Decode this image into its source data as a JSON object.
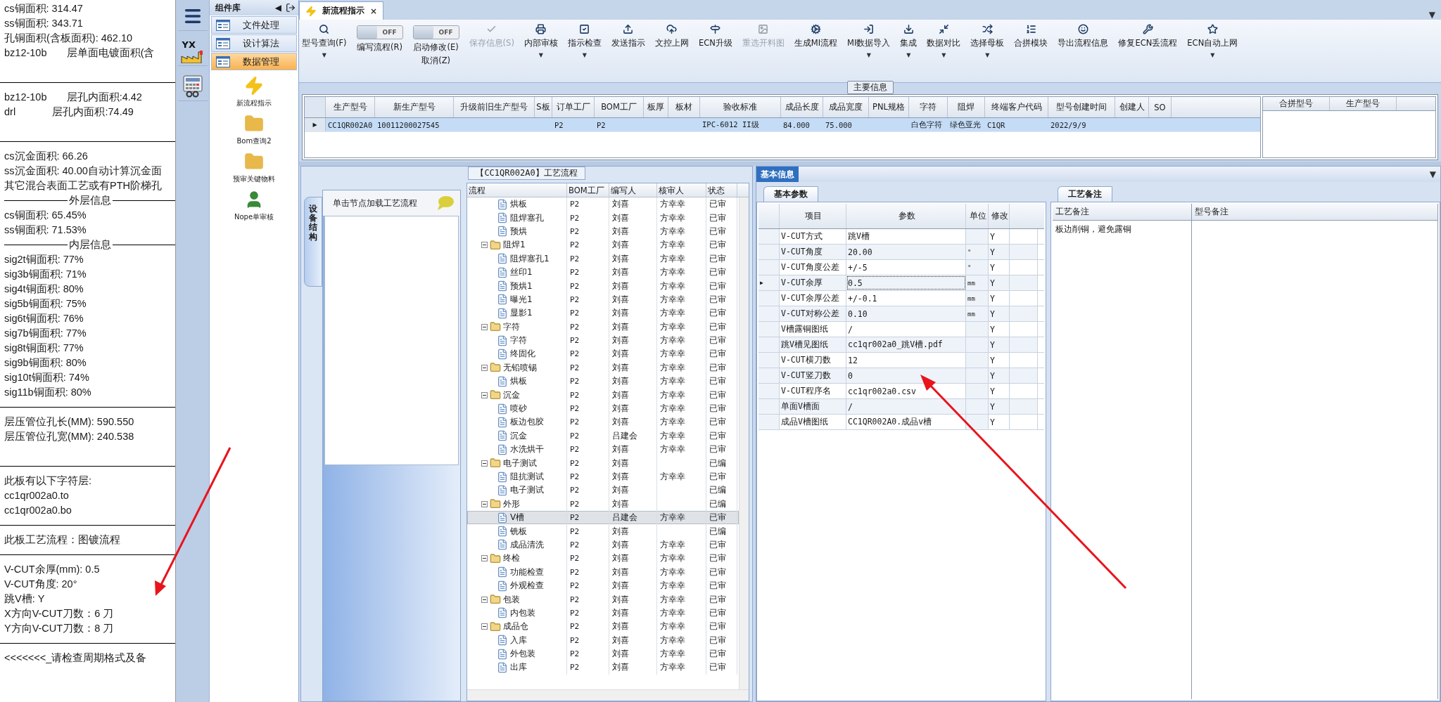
{
  "notes": [
    {
      "kind": "text",
      "text": "cs铜面积: 314.47"
    },
    {
      "kind": "text",
      "text": "ss铜面积: 343.71"
    },
    {
      "kind": "text",
      "text": "孔铜面积(含板面积): 462.10"
    },
    {
      "kind": "text",
      "text": "bz12-10b       层单面电镀面积(含"
    },
    {
      "kind": "gap"
    },
    {
      "kind": "rule"
    },
    {
      "kind": "text",
      "text": "bz12-10b       层孔内面积:4.42"
    },
    {
      "kind": "text",
      "text": "drl             层孔内面积:74.49"
    },
    {
      "kind": "gap"
    },
    {
      "kind": "rule"
    },
    {
      "kind": "text",
      "text": "cs沉金面积: 66.26"
    },
    {
      "kind": "text",
      "text": "ss沉金面积: 40.00自动计算沉金面"
    },
    {
      "kind": "text",
      "text": "其它混合表面工艺或有PTH阶梯孔"
    },
    {
      "kind": "heading",
      "text": "外层信息"
    },
    {
      "kind": "text",
      "text": "cs铜面积: 65.45%"
    },
    {
      "kind": "text",
      "text": "ss铜面积: 71.53%"
    },
    {
      "kind": "heading",
      "text": "内层信息"
    },
    {
      "kind": "text",
      "text": "sig2t铜面积: 77%"
    },
    {
      "kind": "text",
      "text": "sig3b铜面积: 71%"
    },
    {
      "kind": "text",
      "text": "sig4t铜面积: 80%"
    },
    {
      "kind": "text",
      "text": "sig5b铜面积: 75%"
    },
    {
      "kind": "text",
      "text": "sig6t铜面积: 76%"
    },
    {
      "kind": "text",
      "text": "sig7b铜面积: 77%"
    },
    {
      "kind": "text",
      "text": "sig8t铜面积: 77%"
    },
    {
      "kind": "text",
      "text": "sig9b铜面积: 80%"
    },
    {
      "kind": "text",
      "text": "sig10t铜面积: 74%"
    },
    {
      "kind": "text",
      "text": "sig11b铜面积: 80%"
    },
    {
      "kind": "rule"
    },
    {
      "kind": "text",
      "text": "层压管位孔长(MM): 590.550"
    },
    {
      "kind": "text",
      "text": "层压管位孔宽(MM): 240.538"
    },
    {
      "kind": "gap"
    },
    {
      "kind": "rule"
    },
    {
      "kind": "text",
      "text": "此板有以下字符层:"
    },
    {
      "kind": "text",
      "text": "cc1qr002a0.to"
    },
    {
      "kind": "text",
      "text": "cc1qr002a0.bo"
    },
    {
      "kind": "rule"
    },
    {
      "kind": "text",
      "text": "此板工艺流程：图镀流程"
    },
    {
      "kind": "rule"
    },
    {
      "kind": "text",
      "text": "V-CUT余厚(mm): 0.5"
    },
    {
      "kind": "text",
      "text": "V-CUT角度: 20°"
    },
    {
      "kind": "text",
      "text": "跳V槽: Y"
    },
    {
      "kind": "text",
      "text": "X方向V-CUT刀数：6 刀"
    },
    {
      "kind": "text",
      "text": "Y方向V-CUT刀数：8 刀"
    },
    {
      "kind": "rule"
    },
    {
      "kind": "text",
      "text": "<<<<<<<_请检查周期格式及备"
    }
  ],
  "app_badge": "YX",
  "library": {
    "title": "组件库",
    "back": "◀",
    "items": [
      {
        "label": "文件处理",
        "selected": false
      },
      {
        "label": "设计算法",
        "selected": false
      },
      {
        "label": "数据管理",
        "selected": true
      }
    ],
    "tools": [
      "新流程指示",
      "Bom查询2",
      "预审关键物料",
      "Nope单审核"
    ]
  },
  "tab": {
    "label": "新流程指示",
    "close": "×",
    "menu": "▼"
  },
  "toolbar": [
    {
      "kind": "button",
      "label": "型号查询(F)",
      "caret": "▼",
      "disabled": false
    },
    {
      "kind": "toggle",
      "label": "编写流程(R)",
      "switch_text": "OFF",
      "on": false
    },
    {
      "kind": "toggle",
      "label": "启动修改(E)",
      "sub_label": "取消(Z)",
      "switch_text": "OFF",
      "on": false
    },
    {
      "kind": "button",
      "label": "保存信息(S)",
      "disabled": true
    },
    {
      "kind": "button",
      "label": "内部审核",
      "caret": "▼",
      "disabled": false
    },
    {
      "kind": "button",
      "label": "指示检查",
      "caret": "▼",
      "disabled": false
    },
    {
      "kind": "button",
      "label": "发送指示",
      "disabled": false
    },
    {
      "kind": "button",
      "label": "文控上网",
      "disabled": false
    },
    {
      "kind": "button",
      "label": "ECN升级",
      "disabled": false
    },
    {
      "kind": "button",
      "label": "重选开料图",
      "disabled": true
    },
    {
      "kind": "button",
      "label": "生成MI流程",
      "disabled": false
    },
    {
      "kind": "button",
      "label": "MI数据导入",
      "caret": "▼",
      "disabled": false
    },
    {
      "kind": "button",
      "label": "集成",
      "caret": "▼",
      "disabled": false
    },
    {
      "kind": "button",
      "label": "数据对比",
      "caret": "▼",
      "disabled": false
    },
    {
      "kind": "button",
      "label": "选择母板",
      "caret": "▼",
      "disabled": false
    },
    {
      "kind": "button",
      "label": "合拼模块",
      "disabled": false
    },
    {
      "kind": "button",
      "label": "导出流程信息",
      "disabled": false
    },
    {
      "kind": "button",
      "label": "修复ECN丢流程",
      "disabled": false
    },
    {
      "kind": "button",
      "label": "ECN自动上网",
      "caret": "▼",
      "disabled": false
    }
  ],
  "main_info": {
    "title": "主要信息",
    "columns": [
      "生产型号",
      "新生产型号",
      "升级前旧生产型号",
      "S板",
      "订单工厂",
      "BOM工厂",
      "板厚",
      "板材",
      "验收标准",
      "成品长度",
      "成品宽度",
      "PNL规格",
      "字符",
      "阻焊",
      "终端客户代码",
      "型号创建时间",
      "创建人",
      "SO"
    ],
    "rows": [
      {
        "selected": true,
        "indicator": "▶",
        "cells": [
          "CC1QR002A0",
          "10011200027545",
          null,
          null,
          "P2",
          "P2",
          null,
          null,
          "IPC-6012 II级",
          "84.000",
          "75.000",
          null,
          "白色字符",
          "绿色亚光",
          "C1QR",
          "2022/9/9",
          null,
          null
        ]
      }
    ],
    "side_columns": [
      "合拼型号",
      "生产型号"
    ]
  },
  "process": {
    "title": "【CC1QR002A0】工艺流程",
    "side_tab": "设备结构",
    "hint": "单击节点加载工艺流程",
    "columns": [
      "流程",
      "BOM工厂",
      "编写人",
      "核审人",
      "状态"
    ],
    "tree": [
      {
        "children": [
          {
            "name": "烘板",
            "factory": "P2",
            "writer": "刘喜",
            "reviewer": "方幸幸",
            "status": "已审",
            "selected": false
          },
          {
            "name": "阻焊塞孔",
            "factory": "P2",
            "writer": "刘喜",
            "reviewer": "方幸幸",
            "status": "已审",
            "selected": false
          },
          {
            "name": "预烘",
            "factory": "P2",
            "writer": "刘喜",
            "reviewer": "方幸幸",
            "status": "已审",
            "selected": false
          }
        ]
      },
      {
        "name": "阻焊1",
        "factory": "P2",
        "writer": "刘喜",
        "reviewer": "方幸幸",
        "status": "已审",
        "selected": false,
        "children": [
          {
            "name": "阻焊塞孔1",
            "factory": "P2",
            "writer": "刘喜",
            "reviewer": "方幸幸",
            "status": "已审",
            "selected": false
          },
          {
            "name": "丝印1",
            "factory": "P2",
            "writer": "刘喜",
            "reviewer": "方幸幸",
            "status": "已审",
            "selected": false
          },
          {
            "name": "预烘1",
            "factory": "P2",
            "writer": "刘喜",
            "reviewer": "方幸幸",
            "status": "已审",
            "selected": false
          },
          {
            "name": "曝光1",
            "factory": "P2",
            "writer": "刘喜",
            "reviewer": "方幸幸",
            "status": "已审",
            "selected": false
          },
          {
            "name": "显影1",
            "factory": "P2",
            "writer": "刘喜",
            "reviewer": "方幸幸",
            "status": "已审",
            "selected": false
          }
        ]
      },
      {
        "name": "字符",
        "factory": "P2",
        "writer": "刘喜",
        "reviewer": "方幸幸",
        "status": "已审",
        "selected": false,
        "children": [
          {
            "name": "字符",
            "factory": "P2",
            "writer": "刘喜",
            "reviewer": "方幸幸",
            "status": "已审",
            "selected": false
          },
          {
            "name": "终固化",
            "factory": "P2",
            "writer": "刘喜",
            "reviewer": "方幸幸",
            "status": "已审",
            "selected": false
          }
        ]
      },
      {
        "name": "无铅喷锡",
        "factory": "P2",
        "writer": "刘喜",
        "reviewer": "方幸幸",
        "status": "已审",
        "selected": false,
        "children": [
          {
            "name": "烘板",
            "factory": "P2",
            "writer": "刘喜",
            "reviewer": "方幸幸",
            "status": "已审",
            "selected": false
          }
        ]
      },
      {
        "name": "沉金",
        "factory": "P2",
        "writer": "刘喜",
        "reviewer": "方幸幸",
        "status": "已审",
        "selected": false,
        "children": [
          {
            "name": "喷砂",
            "factory": "P2",
            "writer": "刘喜",
            "reviewer": "方幸幸",
            "status": "已审",
            "selected": false
          },
          {
            "name": "板边包胶",
            "factory": "P2",
            "writer": "刘喜",
            "reviewer": "方幸幸",
            "status": "已审",
            "selected": false
          },
          {
            "name": "沉金",
            "factory": "P2",
            "writer": "吕建会",
            "reviewer": "方幸幸",
            "status": "已审",
            "selected": false
          },
          {
            "name": "水洗烘干",
            "factory": "P2",
            "writer": "刘喜",
            "reviewer": "方幸幸",
            "status": "已审",
            "selected": false
          }
        ]
      },
      {
        "name": "电子测试",
        "factory": "P2",
        "writer": "刘喜",
        "status": "已编",
        "selected": false,
        "children": [
          {
            "name": "阻抗测试",
            "factory": "P2",
            "writer": "刘喜",
            "reviewer": "方幸幸",
            "status": "已审",
            "selected": false
          },
          {
            "name": "电子测试",
            "factory": "P2",
            "writer": "刘喜",
            "status": "已编",
            "selected": false
          }
        ]
      },
      {
        "name": "外形",
        "factory": "P2",
        "writer": "刘喜",
        "status": "已编",
        "selected": false,
        "children": [
          {
            "name": "V槽",
            "factory": "P2",
            "writer": "吕建会",
            "reviewer": "方幸幸",
            "status": "已审",
            "selected": true
          },
          {
            "name": "铣板",
            "factory": "P2",
            "writer": "刘喜",
            "status": "已编",
            "selected": false
          },
          {
            "name": "成品清洗",
            "factory": "P2",
            "writer": "刘喜",
            "reviewer": "方幸幸",
            "status": "已审",
            "selected": false
          }
        ]
      },
      {
        "name": "终检",
        "factory": "P2",
        "writer": "刘喜",
        "reviewer": "方幸幸",
        "status": "已审",
        "selected": false,
        "children": [
          {
            "name": "功能检查",
            "factory": "P2",
            "writer": "刘喜",
            "reviewer": "方幸幸",
            "status": "已审",
            "selected": false
          },
          {
            "name": "外观检查",
            "factory": "P2",
            "writer": "刘喜",
            "reviewer": "方幸幸",
            "status": "已审",
            "selected": false
          }
        ]
      },
      {
        "name": "包装",
        "factory": "P2",
        "writer": "刘喜",
        "reviewer": "方幸幸",
        "status": "已审",
        "selected": false,
        "children": [
          {
            "name": "内包装",
            "factory": "P2",
            "writer": "刘喜",
            "reviewer": "方幸幸",
            "status": "已审",
            "selected": false
          }
        ]
      },
      {
        "name": "成品仓",
        "factory": "P2",
        "writer": "刘喜",
        "reviewer": "方幸幸",
        "status": "已审",
        "selected": false,
        "children": [
          {
            "name": "入库",
            "factory": "P2",
            "writer": "刘喜",
            "reviewer": "方幸幸",
            "status": "已审",
            "selected": false
          },
          {
            "name": "外包装",
            "factory": "P2",
            "writer": "刘喜",
            "reviewer": "方幸幸",
            "status": "已审",
            "selected": false
          },
          {
            "name": "出库",
            "factory": "P2",
            "writer": "刘喜",
            "reviewer": "方幸幸",
            "status": "已审",
            "selected": false
          }
        ]
      }
    ]
  },
  "basic": {
    "title": "基本信息",
    "params_tab": "基本参数",
    "columns": [
      "项目",
      "参数",
      "单位",
      "修改"
    ],
    "params": [
      {
        "item": "V-CUT方式",
        "value": "跳V槽",
        "modified": "Y",
        "selected": false
      },
      {
        "item": "V-CUT角度",
        "value": "20.00",
        "unit": "°",
        "modified": "Y",
        "selected": false
      },
      {
        "item": "V-CUT角度公差",
        "value": "+/-5",
        "unit": "°",
        "modified": "Y",
        "selected": false
      },
      {
        "item": "V-CUT余厚",
        "value": "0.5",
        "unit": "mm",
        "modified": "Y",
        "selected": true,
        "indicator": "▶"
      },
      {
        "item": "V-CUT余厚公差",
        "value": "+/-0.1",
        "unit": "mm",
        "modified": "Y",
        "selected": false
      },
      {
        "item": "V-CUT对称公差",
        "value": "0.10",
        "unit": "mm",
        "modified": "Y",
        "selected": false
      },
      {
        "item": "V槽露铜图纸",
        "value": "/",
        "modified": "Y",
        "selected": false
      },
      {
        "item": "跳V槽见图纸",
        "value": "cc1qr002a0_跳V槽.pdf",
        "modified": "Y",
        "selected": false
      },
      {
        "item": "V-CUT横刀数",
        "value": "12",
        "modified": "Y",
        "selected": false
      },
      {
        "item": "V-CUT竖刀数",
        "value": "0",
        "modified": "Y",
        "selected": false
      },
      {
        "item": "V-CUT程序名",
        "value": "cc1qr002a0.csv",
        "modified": "Y",
        "selected": false
      },
      {
        "item": "单面V槽面",
        "value": "/",
        "modified": "Y",
        "selected": false
      },
      {
        "item": "成品V槽图纸",
        "value": "CC1QR002A0.成品v槽",
        "modified": "Y",
        "selected": false
      }
    ],
    "remarks_tab": "工艺备注",
    "remark_columns": [
      "工艺备注",
      "型号备注"
    ],
    "process_remark": "板边削铜，避免露铜"
  }
}
